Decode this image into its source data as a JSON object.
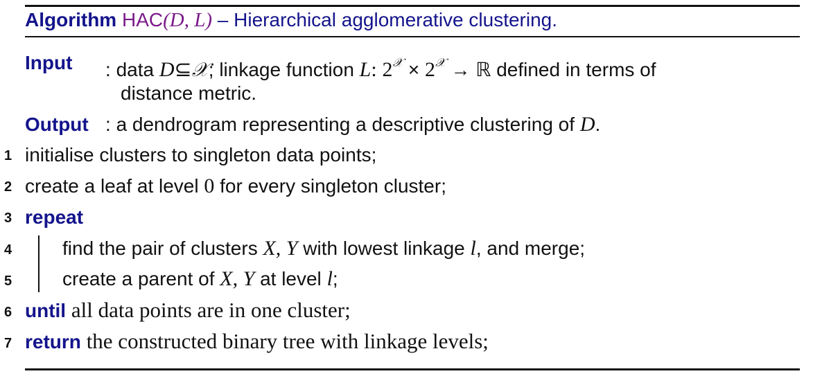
{
  "algorithm": {
    "keyword": "Algorithm",
    "name": "HAC",
    "params": "(D, L)",
    "dash": "–",
    "caption": "Hierarchical agglomerative clustering."
  },
  "input": {
    "label": "Input",
    "colon": ":",
    "text_data": "data",
    "set_D": "D",
    "subset": "⊆",
    "space": "𝒳",
    "semicolon": ";",
    "text_linkage": "linkage function",
    "func_L": "L",
    "func_colon": ":",
    "two_a": "2",
    "sup_a": "𝒳",
    "times": "×",
    "two_b": "2",
    "sup_b": "𝒳",
    "arrow": "→",
    "reals": "ℝ",
    "text_defined": "defined in terms of",
    "text_metric": "distance metric."
  },
  "output": {
    "label": "Output",
    "colon": ":",
    "text": "a dendrogram representing a descriptive clustering of",
    "var_D": "D",
    "period": "."
  },
  "lines": [
    {
      "num": "1",
      "text": "initialise clusters to singleton data points;"
    },
    {
      "num": "2",
      "text_a": "create a leaf at level",
      "zero": "0",
      "text_b": "for every singleton cluster;"
    },
    {
      "num": "3",
      "keyword": "repeat"
    },
    {
      "num": "4",
      "text_a": "find the pair of clusters",
      "vars": "X, Y",
      "text_b": "with lowest linkage",
      "var_l": "l",
      "text_c": ", and merge;"
    },
    {
      "num": "5",
      "text_a": "create a parent of",
      "vars": "X, Y",
      "text_b": "at level",
      "var_l": "l",
      "text_c": ";"
    },
    {
      "num": "6",
      "keyword": "until",
      "text": "all data points are in one cluster;"
    },
    {
      "num": "7",
      "keyword": "return",
      "text": "the constructed binary tree with linkage levels;"
    }
  ]
}
